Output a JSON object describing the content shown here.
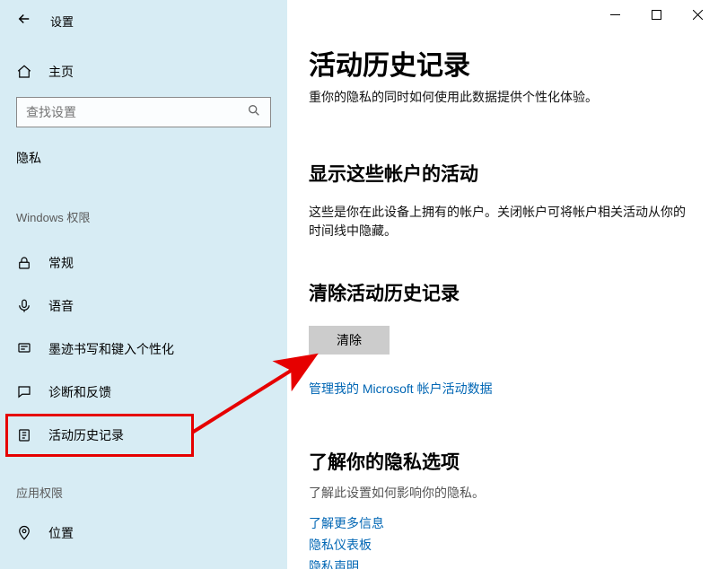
{
  "titlebar": {
    "title": "设置"
  },
  "home": {
    "label": "主页"
  },
  "search": {
    "placeholder": "查找设置"
  },
  "section_privacy": "隐私",
  "section_winperm": "Windows 权限",
  "section_appperm": "应用权限",
  "nav": {
    "general": "常规",
    "speech": "语音",
    "inking": "墨迹书写和键入个性化",
    "diagnostics": "诊断和反馈",
    "activity": "活动历史记录",
    "location": "位置"
  },
  "content": {
    "h1": "活动历史记录",
    "intro_trunc": "重你的隐私的同时如何使用此数据提供个性化体验。",
    "h2_accounts": "显示这些帐户的活动",
    "accounts_desc": "这些是你在此设备上拥有的帐户。关闭帐户可将帐户相关活动从你的时间线中隐藏。",
    "h2_clear": "清除活动历史记录",
    "clear_btn": "清除",
    "manage_link": "管理我的 Microsoft 帐户活动数据",
    "h2_privacy": "了解你的隐私选项",
    "privacy_desc": "了解此设置如何影响你的隐私。",
    "link_more": "了解更多信息",
    "link_dashboard": "隐私仪表板",
    "link_statement": "隐私声明"
  }
}
